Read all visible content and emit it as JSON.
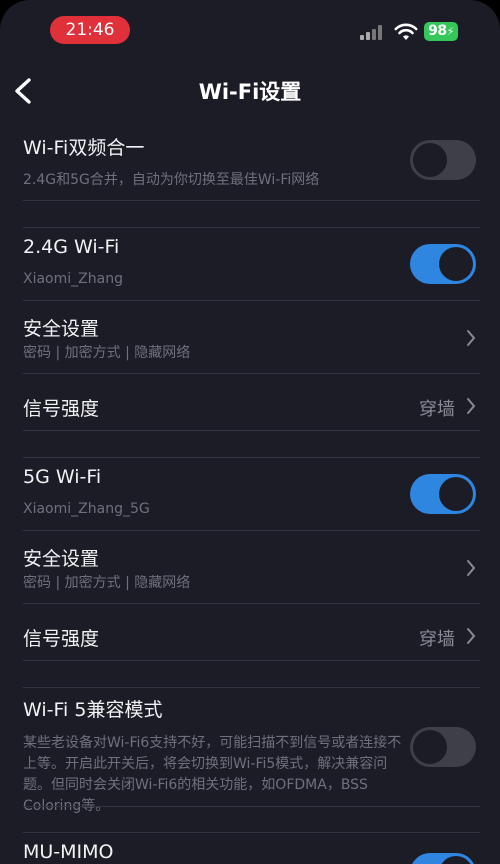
{
  "status_bar": {
    "time": "21:46",
    "battery": "98"
  },
  "header": {
    "title": "Wi-Fi设置"
  },
  "dual_band": {
    "label": "Wi-Fi双频合一",
    "desc": "2.4G和5G合并，自动为你切换至最佳Wi-Fi网络",
    "enabled": false
  },
  "wifi_24": {
    "label": "2.4G Wi-Fi",
    "ssid": "Xiaomi_Zhang",
    "enabled": true,
    "security": {
      "label": "安全设置",
      "desc": "密码 | 加密方式 | 隐藏网络"
    },
    "signal": {
      "label": "信号强度",
      "value": "穿墙"
    }
  },
  "wifi_5": {
    "label": "5G Wi-Fi",
    "ssid": "Xiaomi_Zhang_5G",
    "enabled": true,
    "security": {
      "label": "安全设置",
      "desc": "密码 | 加密方式 | 隐藏网络"
    },
    "signal": {
      "label": "信号强度",
      "value": "穿墙"
    }
  },
  "compat": {
    "label": "Wi-Fi 5兼容模式",
    "desc": "某些老设备对Wi-Fi6支持不好，可能扫描不到信号或者连接不上等。开启此开关后，将会切换到Wi-Fi5模式，解决兼容问题。但同时会关闭Wi-Fi6的相关功能，如OFDMA，BSS Coloring等。",
    "enabled": false
  },
  "mumimo": {
    "label": "MU-MIMO",
    "enabled": true
  },
  "colors": {
    "accent": "#2f86e0",
    "background": "#1c1c27",
    "time_pill": "#e0313b",
    "battery": "#35c759"
  }
}
